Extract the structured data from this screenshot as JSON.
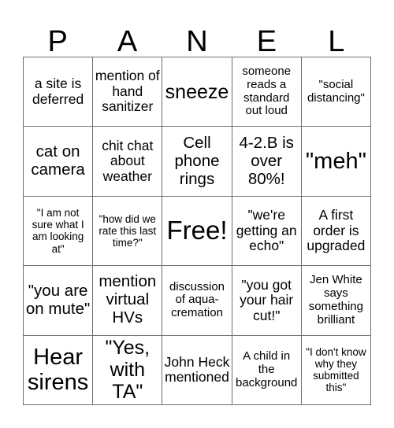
{
  "card": {
    "header_letters": [
      "P",
      "A",
      "N",
      "E",
      "L"
    ],
    "rows": [
      [
        {
          "text": "a site is deferred",
          "size": "sz-m"
        },
        {
          "text": "mention of hand sanitizer",
          "size": "sz-m"
        },
        {
          "text": "sneeze",
          "size": "sz-xl"
        },
        {
          "text": "someone reads a standard out loud",
          "size": "sz-s"
        },
        {
          "text": "\"social distancing\"",
          "size": "sz-s"
        }
      ],
      [
        {
          "text": "cat on camera",
          "size": "sz-l"
        },
        {
          "text": "chit chat about weather",
          "size": "sz-m"
        },
        {
          "text": "Cell phone rings",
          "size": "sz-l"
        },
        {
          "text": "4-2.B is over 80%!",
          "size": "sz-l"
        },
        {
          "text": "\"meh\"",
          "size": "sz-xxl"
        }
      ],
      [
        {
          "text": "\"I am not sure what I am looking at\"",
          "size": "sz-xs"
        },
        {
          "text": "\"how did we rate this last time?\"",
          "size": "sz-xs"
        },
        {
          "text": "Free!",
          "size": "sz-free"
        },
        {
          "text": "\"we're getting an echo\"",
          "size": "sz-m"
        },
        {
          "text": "A first order is upgraded",
          "size": "sz-m"
        }
      ],
      [
        {
          "text": "\"you are on mute\"",
          "size": "sz-l"
        },
        {
          "text": "mention virtual HVs",
          "size": "sz-l"
        },
        {
          "text": "discussion of aqua-cremation",
          "size": "sz-s"
        },
        {
          "text": "\"you got your hair cut!\"",
          "size": "sz-m"
        },
        {
          "text": "Jen White says something brilliant",
          "size": "sz-s"
        }
      ],
      [
        {
          "text": "Hear sirens",
          "size": "sz-xxl"
        },
        {
          "text": "\"Yes, with TA\"",
          "size": "sz-xl"
        },
        {
          "text": "John Heck mentioned",
          "size": "sz-m"
        },
        {
          "text": "A child in the background",
          "size": "sz-s"
        },
        {
          "text": "\"I don't know why they submitted this\"",
          "size": "sz-xs"
        }
      ]
    ]
  },
  "colors": {
    "background": "#ffffff",
    "text": "#000000",
    "grid_line": "#6f6f6f"
  }
}
